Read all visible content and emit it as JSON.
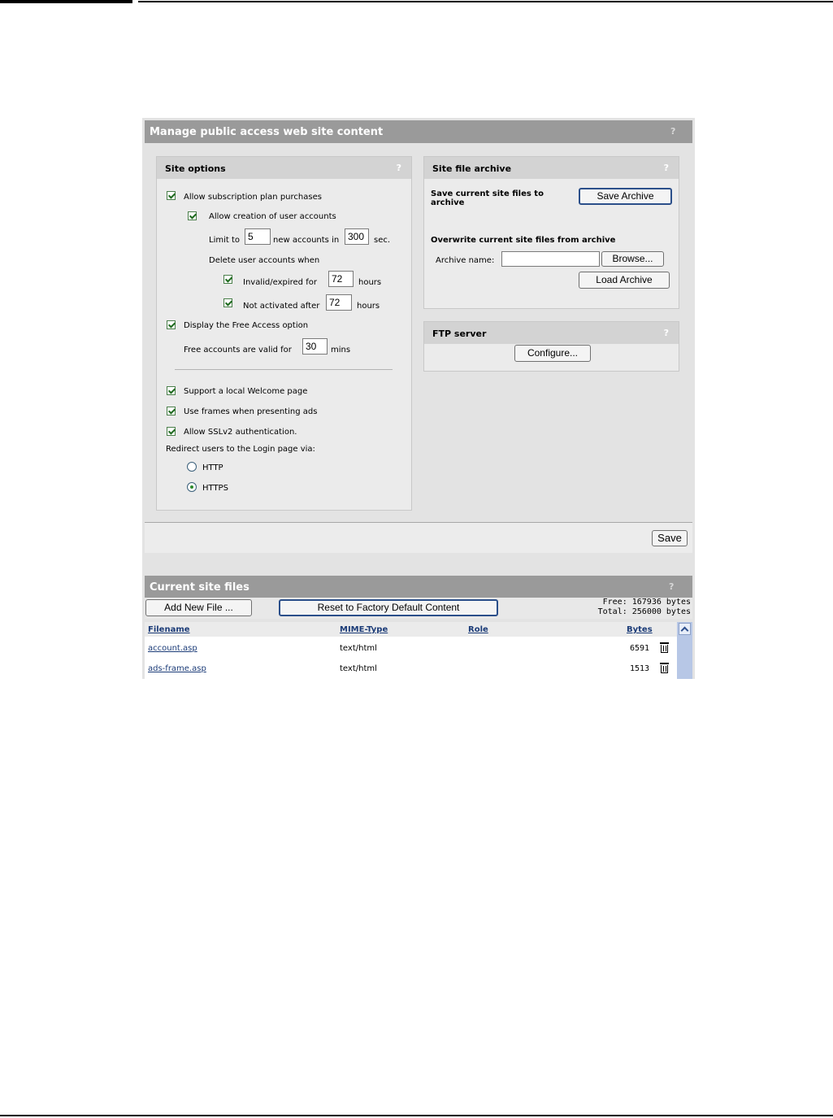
{
  "window": {
    "title": "Manage public access web site content",
    "help": "?"
  },
  "site_options": {
    "title": "Site options",
    "help": "?",
    "allow_subscription": "Allow subscription plan purchases",
    "allow_creation": "Allow creation of user accounts",
    "limit_to": "Limit to",
    "limit_value": "5",
    "new_accounts_in": "new accounts in",
    "seconds_value": "300",
    "sec": "sec.",
    "delete_when": "Delete user accounts when",
    "invalid_expired": "Invalid/expired for",
    "invalid_hours": "72",
    "hours1": "hours",
    "not_activated": "Not activated after",
    "not_activated_hours": "72",
    "hours2": "hours",
    "display_free": "Display the Free Access option",
    "free_valid": "Free accounts are valid for",
    "free_mins": "30",
    "mins": "mins",
    "local_welcome": "Support a local Welcome page",
    "use_frames": "Use frames when presenting ads",
    "allow_sslv2": "Allow SSLv2 authentication.",
    "redirect": "Redirect users to the Login page via:",
    "http": "HTTP",
    "https": "HTTPS"
  },
  "archive": {
    "title": "Site file archive",
    "help": "?",
    "save_current": "Save current site files to archive",
    "save_button": "Save Archive",
    "overwrite": "Overwrite current site files from archive",
    "archive_name": "Archive name:",
    "archive_name_value": "",
    "browse_button": "Browse...",
    "load_button": "Load Archive"
  },
  "ftp": {
    "title": "FTP server",
    "help": "?",
    "configure_button": "Configure..."
  },
  "save_button": "Save",
  "current_files": {
    "title": "Current site files",
    "help": "?",
    "add_button": "Add New File ...",
    "reset_button": "Reset to Factory Default Content",
    "free": "Free: 167936 bytes",
    "total": "Total: 256000 bytes",
    "columns": {
      "filename": "Filename",
      "mime": "MIME-Type",
      "role": "Role",
      "bytes": "Bytes"
    },
    "rows": [
      {
        "filename": "account.asp",
        "mime": "text/html",
        "role": "",
        "bytes": "6591"
      },
      {
        "filename": "ads-frame.asp",
        "mime": "text/html",
        "role": "",
        "bytes": "1513"
      }
    ]
  },
  "icons": [
    "help-icon",
    "checkbox-checked",
    "radio-selected",
    "trash-icon",
    "scroll-up-icon"
  ]
}
